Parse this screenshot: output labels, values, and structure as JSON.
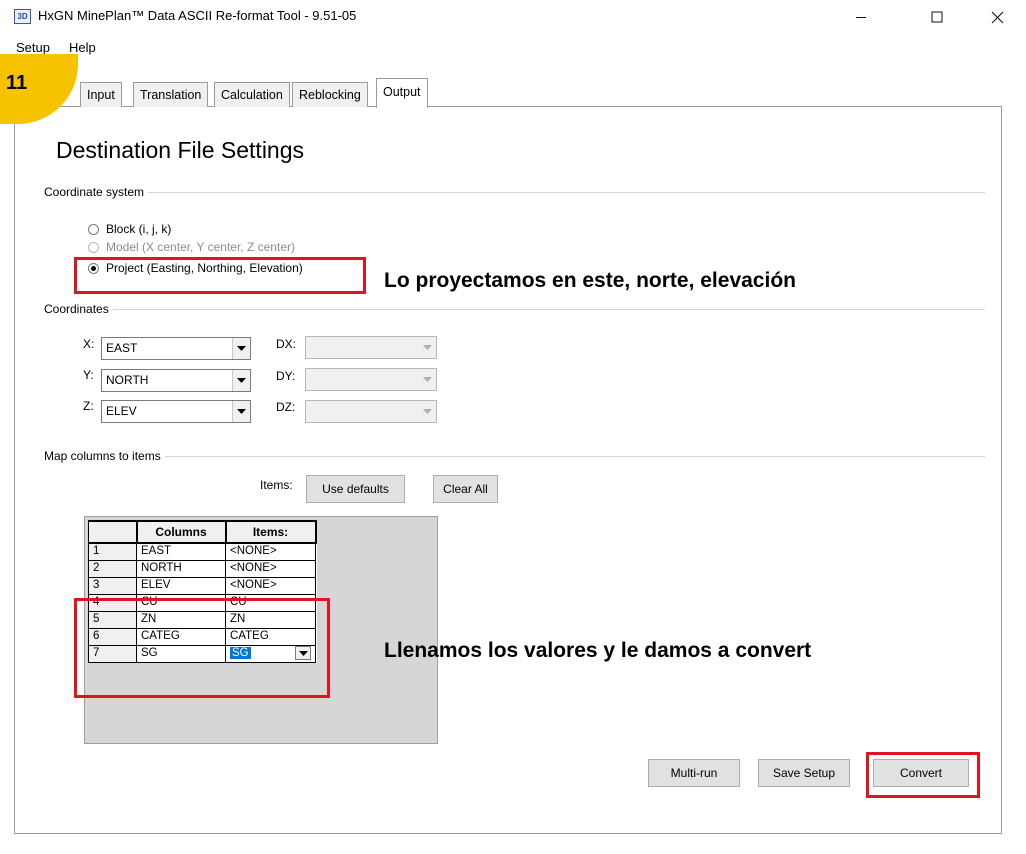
{
  "window": {
    "icon_text": "3D",
    "title": "HxGN MinePlan™ Data ASCII Re-format Tool - 9.51-05"
  },
  "menu": [
    "Setup",
    "Help"
  ],
  "step_badge": "11",
  "tabs": [
    "Input",
    "Translation",
    "Calculation",
    "Reblocking",
    "Output"
  ],
  "active_tab": "Output",
  "heading": "Destination File Settings",
  "coordinate_system": {
    "label": "Coordinate system",
    "options": [
      {
        "label": "Block (i, j, k)",
        "checked": false,
        "enabled": true
      },
      {
        "label": "Model (X center, Y center, Z center)",
        "checked": false,
        "enabled": false
      },
      {
        "label": "Project (Easting, Northing, Elevation)",
        "checked": true,
        "enabled": true
      }
    ]
  },
  "annotations": {
    "project": "Lo proyectamos en este, norte, elevación",
    "fill": "Llenamos los valores y le damos a convert"
  },
  "coordinates": {
    "label": "Coordinates",
    "x_label": "X:",
    "x_value": "EAST",
    "y_label": "Y:",
    "y_value": "NORTH",
    "z_label": "Z:",
    "z_value": "ELEV",
    "dx_label": "DX:",
    "dy_label": "DY:",
    "dz_label": "DZ:"
  },
  "map_columns": {
    "label": "Map columns to items",
    "items_label": "Items:",
    "use_defaults": "Use defaults",
    "clear_all": "Clear All",
    "headers": [
      "Columns",
      "Items:"
    ],
    "rows": [
      {
        "num": "1",
        "column": "EAST",
        "item": "<NONE>"
      },
      {
        "num": "2",
        "column": "NORTH",
        "item": "<NONE>"
      },
      {
        "num": "3",
        "column": "ELEV",
        "item": "<NONE>"
      },
      {
        "num": "4",
        "column": "CU",
        "item": "CU"
      },
      {
        "num": "5",
        "column": "ZN",
        "item": "ZN"
      },
      {
        "num": "6",
        "column": "CATEG",
        "item": "CATEG"
      },
      {
        "num": "7",
        "column": "SG",
        "item": "SG"
      }
    ]
  },
  "buttons": {
    "multi_run": "Multi-run",
    "save_setup": "Save Setup",
    "convert": "Convert"
  },
  "colors": {
    "highlight": "#e0141e",
    "badge": "#f5c300",
    "selection": "#0078d7"
  }
}
